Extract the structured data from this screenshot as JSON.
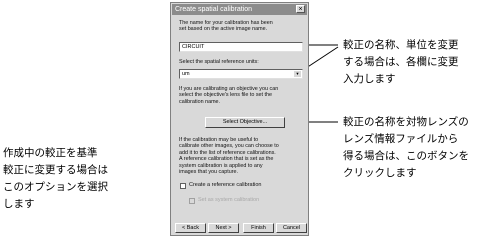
{
  "dialog": {
    "title": "Create spatial calibration",
    "close_icon": "×",
    "intro_text": [
      "The name for your calibration has been",
      "set based on the active image name."
    ],
    "name_value": "CIRCUIT",
    "units_label": "Select the spatial reference units:",
    "units_value": "um",
    "objective_text": [
      "If you are calibrating an objective you can",
      "select the objective's lens file to set the",
      "calibration name."
    ],
    "select_objective_label": "Select Objective...",
    "reference_text": [
      "If the calibration may be useful to",
      "calibrate other images, you can choose to",
      "add it to the list of reference calibrations.",
      "A reference calibration that is set as the",
      "system calibration is applied to any",
      "images that you capture."
    ],
    "create_reference_label": "Create a reference calibration",
    "system_calibration_label": "Set as system calibration",
    "buttons": {
      "back": "< Back",
      "next": "Next >",
      "finish": "Finish",
      "cancel": "Cancel"
    }
  },
  "annotations": {
    "right_top": [
      "較正の名称、単位を変更",
      "する場合は、各欄に変更",
      "入力します"
    ],
    "right_bottom": [
      "較正の名称を対物レンズの",
      "レンズ情報ファイルから",
      "得る場合は、このボタンを",
      "クリックします"
    ],
    "left": [
      "作成中の較正を基準",
      "較正に変更する場合は",
      "このオプションを選択",
      "します"
    ]
  }
}
